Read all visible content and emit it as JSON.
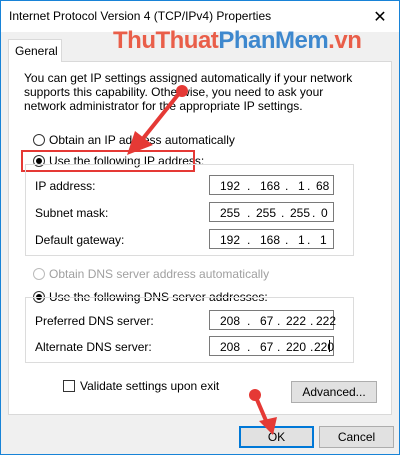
{
  "window": {
    "title": "Internet Protocol Version 4 (TCP/IPv4) Properties",
    "close_glyph": "✕"
  },
  "tabs": [
    {
      "label": "General"
    }
  ],
  "watermark": {
    "part1": "ThuThuat",
    "part2": "PhanMem",
    "part3": ".vn"
  },
  "description": "You can get IP settings assigned automatically if your network supports this capability. Otherwise, you need to ask your network administrator for the appropriate IP settings.",
  "ip_section": {
    "auto_label": "Obtain an IP address automatically",
    "manual_label": "Use the following IP address:",
    "selected": "manual",
    "fields": [
      {
        "label": "IP address:",
        "octets": [
          "192",
          "168",
          "1",
          "68"
        ]
      },
      {
        "label": "Subnet mask:",
        "octets": [
          "255",
          "255",
          "255",
          "0"
        ]
      },
      {
        "label": "Default gateway:",
        "octets": [
          "192",
          "168",
          "1",
          "1"
        ]
      }
    ]
  },
  "dns_section": {
    "auto_label": "Obtain DNS server address automatically",
    "manual_label": "Use the following DNS server addresses:",
    "selected": "manual",
    "fields": [
      {
        "label": "Preferred DNS server:",
        "octets": [
          "208",
          "67",
          "222",
          "222"
        ]
      },
      {
        "label": "Alternate DNS server:",
        "octets": [
          "208",
          "67",
          "220",
          "220"
        ]
      }
    ]
  },
  "validate_label": "Validate settings upon exit",
  "buttons": {
    "advanced": "Advanced...",
    "ok": "OK",
    "cancel": "Cancel"
  },
  "colors": {
    "highlight": "#e53935",
    "accent": "#0078d7"
  }
}
